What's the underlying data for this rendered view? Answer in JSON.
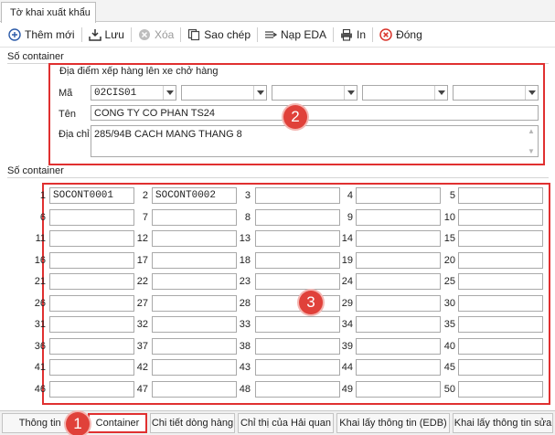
{
  "window": {
    "tab_title": "Tờ khai xuất khẩu"
  },
  "toolbar": {
    "add": "Thêm mới",
    "save": "Lưu",
    "delete": "Xóa",
    "copy": "Sao chép",
    "load_eda": "Nạp EDA",
    "print": "In",
    "close": "Đóng"
  },
  "section1": {
    "title": "Số container"
  },
  "loading_place": {
    "group_label": "Địa điểm xếp hàng lên xe chở hàng",
    "code_label": "Mã",
    "codes": [
      "02CIS01",
      "",
      "",
      "",
      ""
    ],
    "name_label": "Tên",
    "name": "CONG TY CO PHAN TS24",
    "address_label": "Địa chỉ",
    "address": "285/94B CACH MANG THANG 8"
  },
  "section2": {
    "title": "Số container"
  },
  "containers": [
    {
      "no": "1",
      "value": "SOCONT0001"
    },
    {
      "no": "2",
      "value": "SOCONT0002"
    },
    {
      "no": "3",
      "value": ""
    },
    {
      "no": "4",
      "value": ""
    },
    {
      "no": "5",
      "value": ""
    },
    {
      "no": "6",
      "value": ""
    },
    {
      "no": "7",
      "value": ""
    },
    {
      "no": "8",
      "value": ""
    },
    {
      "no": "9",
      "value": ""
    },
    {
      "no": "10",
      "value": ""
    },
    {
      "no": "11",
      "value": ""
    },
    {
      "no": "12",
      "value": ""
    },
    {
      "no": "13",
      "value": ""
    },
    {
      "no": "14",
      "value": ""
    },
    {
      "no": "15",
      "value": ""
    },
    {
      "no": "16",
      "value": ""
    },
    {
      "no": "17",
      "value": ""
    },
    {
      "no": "18",
      "value": ""
    },
    {
      "no": "19",
      "value": ""
    },
    {
      "no": "20",
      "value": ""
    },
    {
      "no": "21",
      "value": ""
    },
    {
      "no": "22",
      "value": ""
    },
    {
      "no": "23",
      "value": ""
    },
    {
      "no": "24",
      "value": ""
    },
    {
      "no": "25",
      "value": ""
    },
    {
      "no": "26",
      "value": ""
    },
    {
      "no": "27",
      "value": ""
    },
    {
      "no": "28",
      "value": ""
    },
    {
      "no": "29",
      "value": ""
    },
    {
      "no": "30",
      "value": ""
    },
    {
      "no": "31",
      "value": ""
    },
    {
      "no": "32",
      "value": ""
    },
    {
      "no": "33",
      "value": ""
    },
    {
      "no": "34",
      "value": ""
    },
    {
      "no": "35",
      "value": ""
    },
    {
      "no": "36",
      "value": ""
    },
    {
      "no": "37",
      "value": ""
    },
    {
      "no": "38",
      "value": ""
    },
    {
      "no": "39",
      "value": ""
    },
    {
      "no": "40",
      "value": ""
    },
    {
      "no": "41",
      "value": ""
    },
    {
      "no": "42",
      "value": ""
    },
    {
      "no": "43",
      "value": ""
    },
    {
      "no": "44",
      "value": ""
    },
    {
      "no": "45",
      "value": ""
    },
    {
      "no": "46",
      "value": ""
    },
    {
      "no": "47",
      "value": ""
    },
    {
      "no": "48",
      "value": ""
    },
    {
      "no": "49",
      "value": ""
    },
    {
      "no": "50",
      "value": ""
    }
  ],
  "badges": [
    "1",
    "2",
    "3"
  ],
  "bottom_tabs": [
    {
      "label": "Thông tin c"
    },
    {
      "label": "Container"
    },
    {
      "label": "Chi tiết dòng hàng"
    },
    {
      "label": "Chỉ thị của Hải quan"
    },
    {
      "label": "Khai lấy thông tin (EDB)"
    },
    {
      "label": "Khai lấy thông tin sửa"
    }
  ],
  "colors": {
    "highlight": "#e03030",
    "badge": "#e0413a"
  }
}
